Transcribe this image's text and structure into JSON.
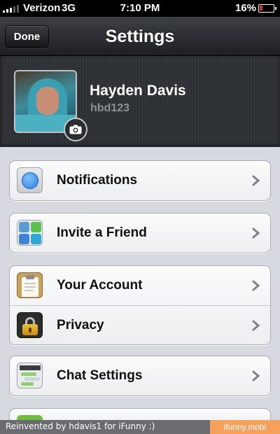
{
  "status_bar": {
    "carrier": "Verizon",
    "network": "3G",
    "time": "7:10 PM",
    "battery": "16%",
    "battery_level": 0.16
  },
  "nav": {
    "done_label": "Done",
    "title": "Settings"
  },
  "profile": {
    "name": "Hayden Davis",
    "username": "hbd123"
  },
  "menu": {
    "notifications": "Notifications",
    "invite": "Invite a Friend",
    "account": "Your Account",
    "privacy": "Privacy",
    "chat": "Chat Settings"
  },
  "footer": {
    "left": "Reinvented by hdavis1 for iFunny :)",
    "right": "ifunny.mobi"
  },
  "colors": {
    "accent": "#3a8ff0",
    "battery_low": "#e52a2a"
  }
}
